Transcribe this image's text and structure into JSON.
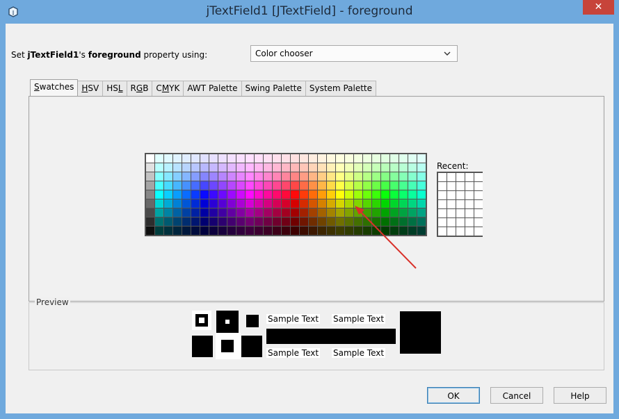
{
  "window": {
    "title": "jTextField1 [JTextField] - foreground",
    "close_glyph": "✕"
  },
  "property_row": {
    "prefix": "Set ",
    "component": "jTextField1",
    "middle": "'s ",
    "property": "foreground",
    "suffix": " property using:",
    "chooser_value": "Color chooser"
  },
  "tabs": [
    {
      "label": "Swatches",
      "mnemonic_index": 0,
      "active": true
    },
    {
      "label": "HSV",
      "mnemonic_index": 0,
      "active": false
    },
    {
      "label": "HSL",
      "mnemonic_index": 2,
      "active": false
    },
    {
      "label": "RGB",
      "mnemonic_index": 1,
      "active": false
    },
    {
      "label": "CMYK",
      "mnemonic_index": 1,
      "active": false
    },
    {
      "label": "AWT Palette",
      "active": false
    },
    {
      "label": "Swing Palette",
      "active": false
    },
    {
      "label": "System Palette",
      "active": false
    }
  ],
  "swatches": {
    "recent_label": "Recent:",
    "columns": 31,
    "rows": 9,
    "recent_columns": 5,
    "recent_rows": 7
  },
  "annotation": {
    "arrow_color": "#d9312a"
  },
  "preview": {
    "label": "Preview",
    "sample_text_1": "Sample Text",
    "sample_text_2": "Sample Text",
    "sample_text_3": "Sample Text",
    "sample_text_4": "Sample Text",
    "color": "#000000"
  },
  "buttons": {
    "ok": "OK",
    "cancel": "Cancel",
    "help": "Help"
  },
  "colors": {
    "titlebar": "#6fa9dd",
    "close": "#c7443a"
  }
}
